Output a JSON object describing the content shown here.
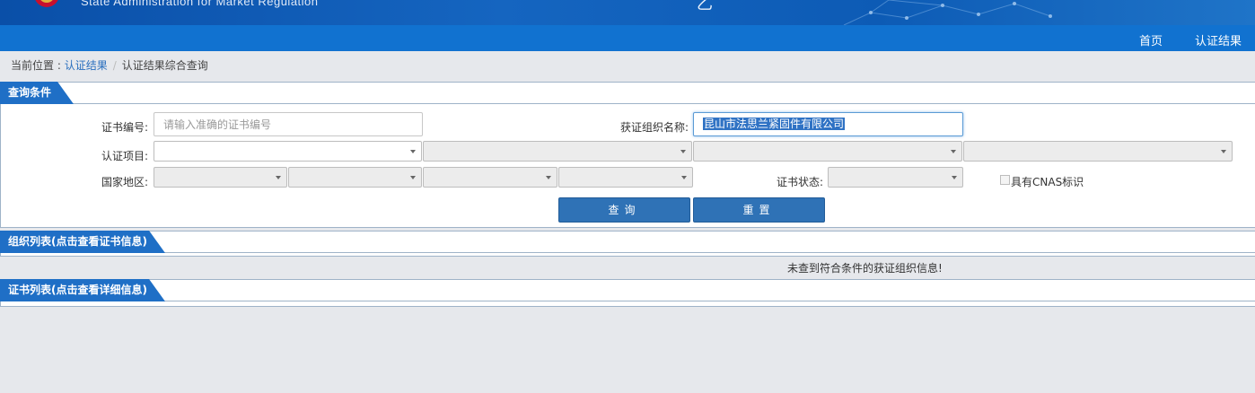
{
  "header": {
    "subtitle": "State Administration  for  Market Regulation",
    "center_glyph": "乙",
    "nav": [
      {
        "label": "首页"
      },
      {
        "label": "认证结果"
      }
    ]
  },
  "breadcrumb": {
    "prefix": "当前位置 : ",
    "link": "认证结果",
    "separator": "/",
    "current": "认证结果综合查询"
  },
  "query_panel": {
    "title": "查询条件",
    "fields": {
      "cert_no_label": "证书编号:",
      "cert_no_placeholder": "请输入准确的证书编号",
      "cert_no_value": "",
      "org_name_label": "获证组织名称:",
      "org_name_value": "昆山市法思兰紧固件有限公司",
      "project_label": "认证项目:",
      "region_label": "国家地区:",
      "status_label": "证书状态:",
      "cnas_label": "具有CNAS标识"
    },
    "buttons": {
      "search": "查询",
      "reset": "重置"
    }
  },
  "org_panel": {
    "title": "组织列表(点击查看证书信息)",
    "empty_message": "未查到符合条件的获证组织信息!"
  },
  "cert_panel": {
    "title": "证书列表(点击查看详细信息)"
  },
  "colors": {
    "nav_bar": "#1172d0",
    "tab": "#1f6fc6",
    "button": "#2f72b6",
    "page_bg": "#e6e8ec"
  }
}
